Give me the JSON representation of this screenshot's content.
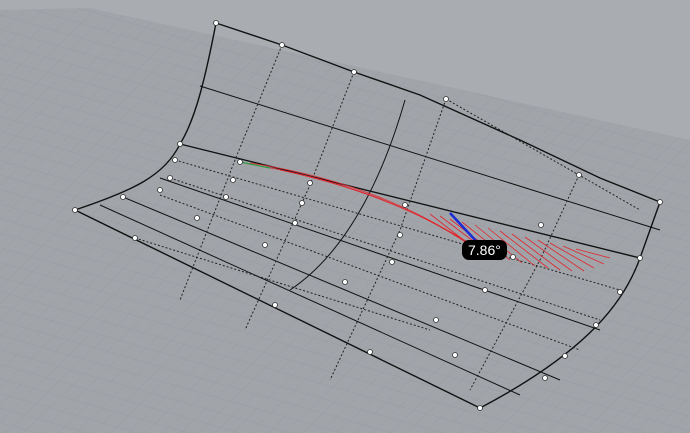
{
  "viewport": {
    "angle_readout": "7.86°",
    "colors": {
      "background": "#a9adb2",
      "grid_plane": "#a0a4a9",
      "grid_line": "#8e9297",
      "edge": "#111111",
      "curvature_hair": "#e0262d",
      "angle_vector": "#1a2bd6",
      "start_vector": "#2e9a3a"
    }
  }
}
